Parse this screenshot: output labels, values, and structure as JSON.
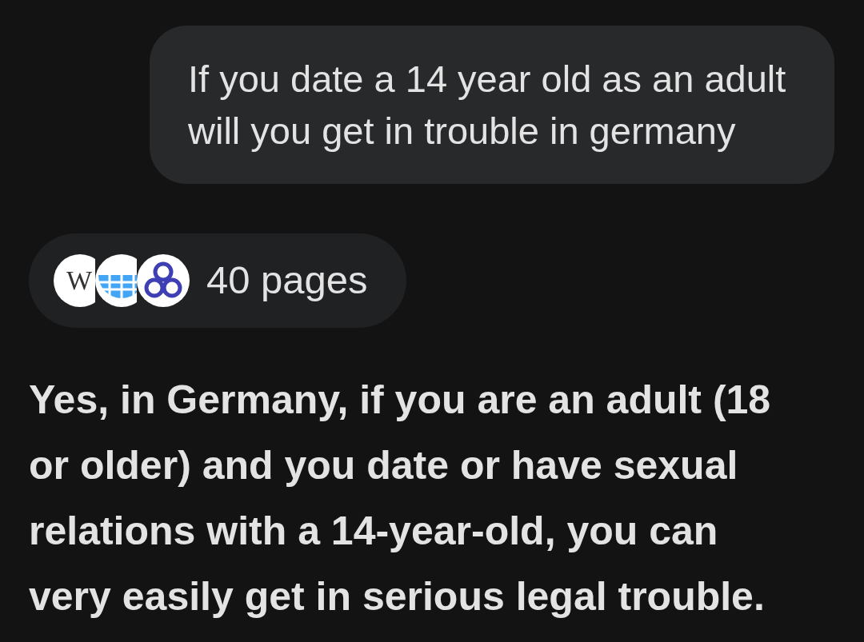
{
  "user_message": {
    "text": "If you date a 14 year old as an adult will you get in trouble in germany"
  },
  "sources_chip": {
    "icons": [
      {
        "kind": "wikipedia",
        "letter": "W"
      },
      {
        "kind": "globe"
      },
      {
        "kind": "knot"
      }
    ],
    "label": "40 pages"
  },
  "answer": {
    "text": "Yes, in Germany, if you are an adult (18 or older) and you date or have sexual relations with a 14-year-old, you can very easily get in serious legal trouble."
  }
}
